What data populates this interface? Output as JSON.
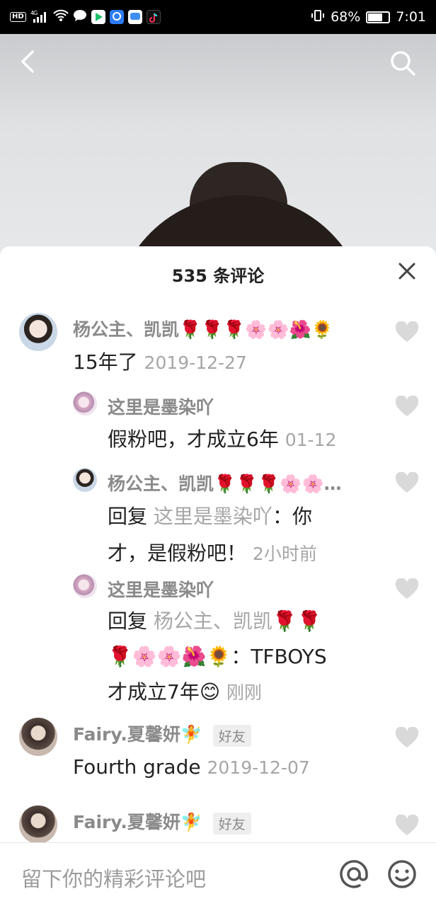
{
  "status_bar": {
    "left_badges": [
      "HD",
      "4G"
    ],
    "battery": "68%",
    "time": "7:01"
  },
  "video": {
    "icons": [
      "back-arrow-icon",
      "search-icon"
    ]
  },
  "comments_panel": {
    "title": "535 条评论",
    "comments": [
      {
        "name": "杨公主、凯凯🌹🌹🌹🌸🌸🌺🌻",
        "text": "15年了",
        "time": "2019-12-27",
        "replies": [
          {
            "name": "这里是墨染吖",
            "text": "假粉吧，才成立6年",
            "time": "01-12"
          },
          {
            "name": "杨公主、凯凯🌹🌹🌹🌸🌸…",
            "prefix": "回复",
            "target": "这里是墨染吖",
            "text_line1": "：你",
            "text_line2": "才，是假粉吧！",
            "time": "2小时前"
          },
          {
            "name": "这里是墨染吖",
            "prefix": "回复",
            "target": "杨公主、凯凯🌹🌹",
            "target_line2": "🌹🌸🌸🌺🌻",
            "text_line2": "：TFBOYS",
            "text_line3": "才成立7年😊",
            "time": "刚刚"
          }
        ]
      },
      {
        "name": "Fairy.夏馨妍🧚",
        "badge": "好友",
        "text": "Fourth grade",
        "time": "2019-12-07"
      },
      {
        "name": "Fairy.夏馨妍🧚",
        "badge": "好友"
      }
    ]
  },
  "comment_input": {
    "placeholder": "留下你的精彩评论吧",
    "icons": [
      "at-icon",
      "emoji-icon"
    ]
  },
  "colors": {
    "accent_heart": "#d9d9d9",
    "name_grey": "#8a8a8a"
  }
}
